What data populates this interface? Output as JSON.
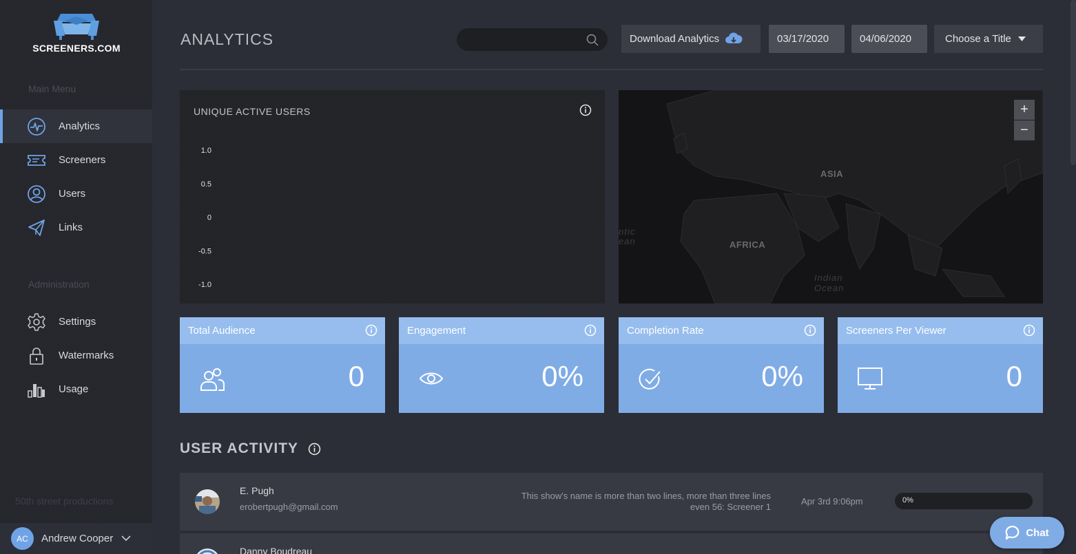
{
  "brand": {
    "name": "SCREENERS.COM"
  },
  "sidebar": {
    "main_heading": "Main Menu",
    "main_items": [
      {
        "label": "Analytics",
        "icon": "pulse-icon",
        "active": true
      },
      {
        "label": "Screeners",
        "icon": "ticket-icon",
        "active": false
      },
      {
        "label": "Users",
        "icon": "user-circle-icon",
        "active": false
      },
      {
        "label": "Links",
        "icon": "paper-plane-icon",
        "active": false
      }
    ],
    "admin_heading": "Administration",
    "admin_items": [
      {
        "label": "Settings",
        "icon": "gear-icon"
      },
      {
        "label": "Watermarks",
        "icon": "lock-icon"
      },
      {
        "label": "Usage",
        "icon": "bar-chart-icon"
      }
    ],
    "company": "50th street productions",
    "user": {
      "initials": "AC",
      "name": "Andrew Cooper"
    }
  },
  "header": {
    "title": "ANALYTICS",
    "search_placeholder": "",
    "download_label": "Download Analytics",
    "start_date": "03/17/2020",
    "end_date": "04/06/2020",
    "title_select": "Choose a Title"
  },
  "chart": {
    "title": "UNIQUE ACTIVE USERS"
  },
  "chart_data": {
    "type": "line",
    "title": "UNIQUE ACTIVE USERS",
    "xlabel": "",
    "ylabel": "",
    "yticks": [
      "1.0",
      "0.5",
      "0",
      "-0.5",
      "-1.0"
    ],
    "ylim": [
      -1.0,
      1.0
    ],
    "series": []
  },
  "map": {
    "labels": {
      "asia": "ASIA",
      "africa": "AFRICA",
      "indian": "Indian",
      "ocean": "Ocean",
      "atlantic1": "ntic",
      "atlantic2": "ean"
    },
    "zoom_in": "+",
    "zoom_out": "−"
  },
  "stats": [
    {
      "label": "Total Audience",
      "value": "0",
      "icon": "users-icon"
    },
    {
      "label": "Engagement",
      "value": "0%",
      "icon": "eye-icon"
    },
    {
      "label": "Completion Rate",
      "value": "0%",
      "icon": "check-circle-icon"
    },
    {
      "label": "Screeners Per Viewer",
      "value": "0",
      "icon": "monitor-icon"
    }
  ],
  "activity": {
    "title": "USER ACTIVITY",
    "rows": [
      {
        "name": "E. Pugh",
        "email": "erobertpugh@gmail.com",
        "show_line1": "This show's name is more than two lines, more than three lines",
        "show_line2": "even 56: Screener 1",
        "time": "Apr 3rd 9:06pm",
        "progress_label": "0%",
        "progress": 0
      },
      {
        "name": "Danny Boudreau",
        "email": "",
        "show_line1": "",
        "show_line2": "",
        "time": "",
        "progress_label": "",
        "progress": 0
      }
    ]
  },
  "chat": {
    "label": "Chat"
  },
  "colors": {
    "accent": "#6fa3e6",
    "card": "#80ace6",
    "card_head": "#96bdee"
  }
}
